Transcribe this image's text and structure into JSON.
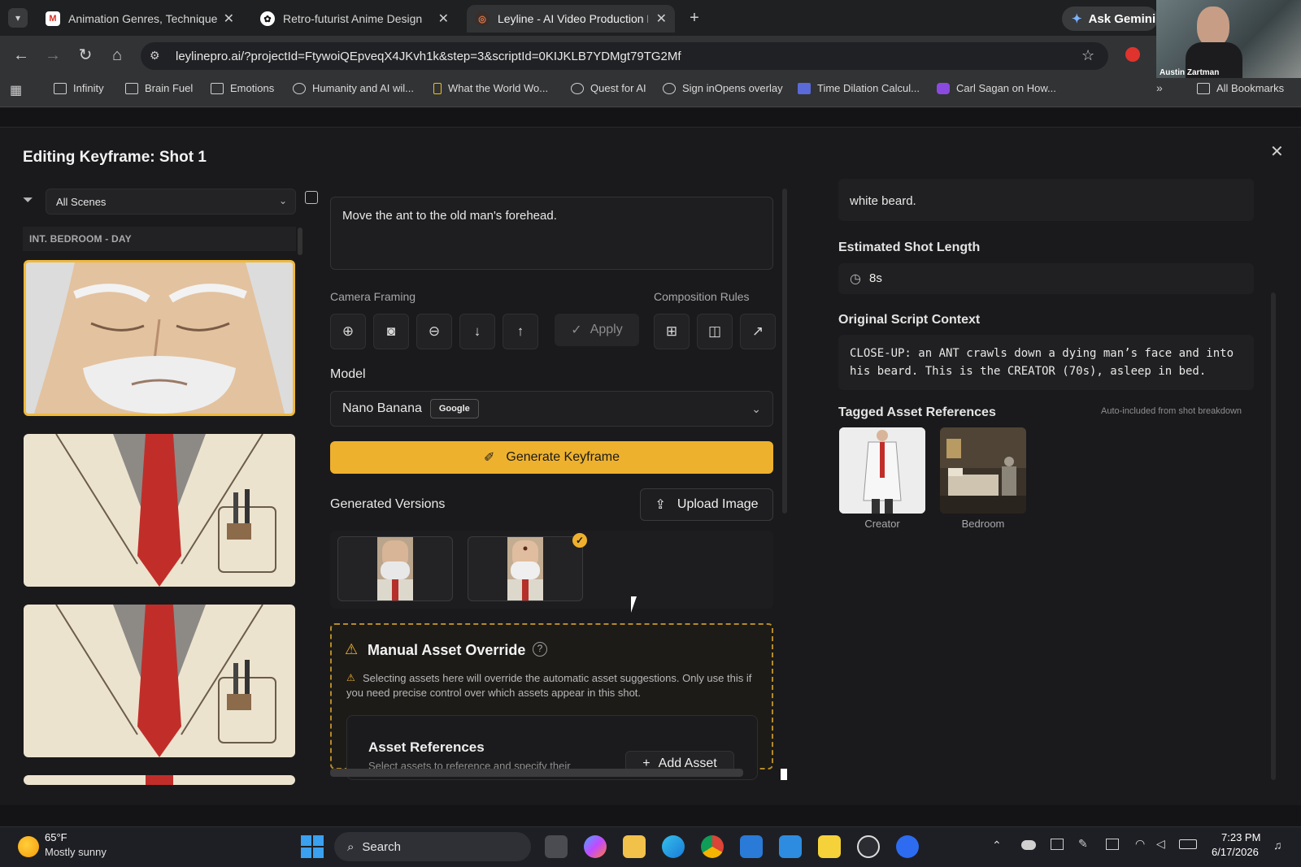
{
  "browser": {
    "tabs": [
      {
        "title": "Animation Genres, Technique a",
        "favicon": "gmail-icon"
      },
      {
        "title": "Retro-futurist Anime Design",
        "favicon": "chatgpt-icon"
      },
      {
        "title": "Leyline - AI Video Production P",
        "favicon": "leyline-icon"
      }
    ],
    "url": "leylinepro.ai/?projectId=FtywoiQEpveqX4JKvh1k&step=3&scriptId=0KIJKLB7YDMgt79TG2Mf",
    "ask_gemini": "Ask Gemini",
    "webcam_name": "Austin Zartman",
    "bookmarks": [
      "Infinity",
      "Brain Fuel",
      "Emotions",
      "Humanity and AI wil...",
      "What the World Wo...",
      "Quest for AI",
      "Sign inOpens overlay",
      "Time Dilation Calcul...",
      "Carl Sagan on How..."
    ],
    "all_bookmarks": "All Bookmarks"
  },
  "modal": {
    "title": "Editing Keyframe: Shot 1",
    "close": "×"
  },
  "left": {
    "scene_filter": "All Scenes",
    "scene_header": "INT. BEDROOM - DAY"
  },
  "center": {
    "prompt": "Move the ant to the old man's forehead.",
    "camera_framing_label": "Camera Framing",
    "composition_rules_label": "Composition Rules",
    "apply_label": "Apply",
    "model_label": "Model",
    "model_value": "Nano Banana",
    "model_badge": "Google",
    "generate_label": "Generate Keyframe",
    "versions_label": "Generated Versions",
    "upload_label": "Upload Image",
    "override_title": "Manual Asset Override",
    "override_text": "Selecting assets here will override the automatic asset suggestions. Only use this if you need precise control over which assets appear in this shot.",
    "assets_title": "Asset References",
    "assets_sub": "Select assets to reference and specify their",
    "add_asset": "Add Asset"
  },
  "right": {
    "desc_tail": "white beard.",
    "shot_length_label": "Estimated Shot Length",
    "shot_length_value": "8s",
    "script_label": "Original Script Context",
    "script_text": "CLOSE-UP: an ANT crawls down a dying man’s face and into his beard. This is the CREATOR (70s), asleep in bed.",
    "tagged_label": "Tagged Asset References",
    "tagged_note": "Auto-included from shot breakdown",
    "assets": [
      "Creator",
      "Bedroom"
    ]
  },
  "taskbar": {
    "temp": "65°F",
    "weather": "Mostly sunny",
    "search": "Search",
    "time": "7:23 PM",
    "date": "6/17/2026"
  }
}
